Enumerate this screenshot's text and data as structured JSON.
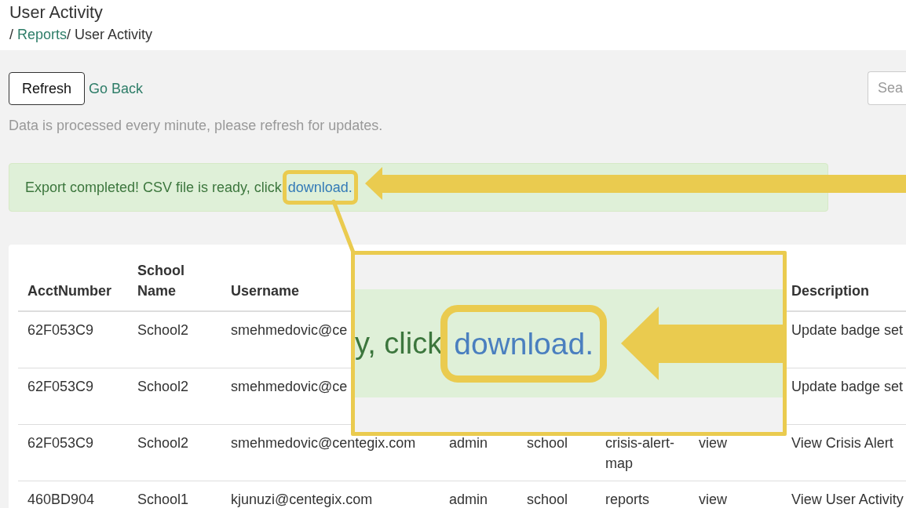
{
  "header": {
    "title": "User Activity",
    "breadcrumb": [
      {
        "kind": "separator",
        "text": "/"
      },
      {
        "kind": "link",
        "text": "Reports"
      },
      {
        "kind": "separator",
        "text": "/"
      },
      {
        "kind": "current",
        "text": "User Activity"
      }
    ]
  },
  "toolbar": {
    "refresh_button": "Refresh",
    "back_link": "Go Back",
    "search": {
      "placeholder": "Sea"
    }
  },
  "note": "Data is processed every minute, please refresh for updates.",
  "alert": {
    "text": "Export completed! CSV file is ready, click",
    "link": "download."
  },
  "table": {
    "columns": [
      "AcctNumber",
      "School Name",
      "Username",
      null,
      null,
      null,
      null,
      "Description"
    ],
    "rows": [
      [
        "62F053C9",
        "School2",
        "smehmedovic@ce",
        null,
        null,
        null,
        null,
        "Update badge set"
      ],
      [
        "62F053C9",
        "School2",
        "smehmedovic@ce",
        null,
        null,
        null,
        null,
        "Update badge set"
      ],
      [
        "62F053C9",
        "School2",
        "smehmedovic@centegix.com",
        "admin",
        "school",
        "crisis-alert-map",
        "view",
        "View Crisis Alert"
      ],
      [
        "460BD904",
        "School1",
        "kjunuzi@centegix.com",
        "admin",
        "school",
        "reports",
        "view",
        "View User Activity"
      ]
    ]
  },
  "magnifier": {
    "text": "y, click",
    "link": "download."
  }
}
